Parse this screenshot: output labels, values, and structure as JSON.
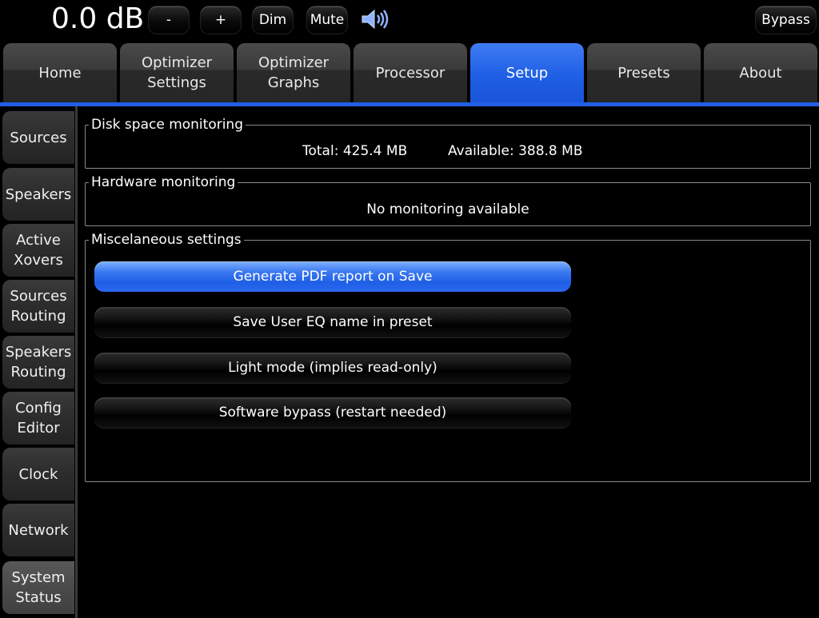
{
  "topbar": {
    "volume": "0.0 dB",
    "minus_label": "-",
    "plus_label": "+",
    "dim_label": "Dim",
    "mute_label": "Mute",
    "speaker_icon": "speaker-volume-icon",
    "bypass_label": "Bypass"
  },
  "tabs": [
    {
      "label": "Home"
    },
    {
      "label": "Optimizer\nSettings"
    },
    {
      "label": "Optimizer\nGraphs"
    },
    {
      "label": "Processor"
    },
    {
      "label": "Setup",
      "active": true
    },
    {
      "label": "Presets"
    },
    {
      "label": "About"
    }
  ],
  "sidebar": {
    "items": [
      {
        "label": "Sources"
      },
      {
        "label": "Speakers"
      },
      {
        "label": "Active\nXovers"
      },
      {
        "label": "Sources\nRouting"
      },
      {
        "label": "Speakers\nRouting"
      },
      {
        "label": "Config\nEditor"
      },
      {
        "label": "Clock"
      },
      {
        "label": "Network"
      },
      {
        "label": "System\nStatus",
        "active": true
      }
    ]
  },
  "disk": {
    "title": "Disk space monitoring",
    "total": "Total: 425.4 MB",
    "available": "Available: 388.8 MB"
  },
  "hardware": {
    "title": "Hardware monitoring",
    "status": "No monitoring available"
  },
  "misc": {
    "title": "Miscelaneous settings",
    "options": [
      {
        "label": "Generate PDF report on Save",
        "on": true
      },
      {
        "label": "Save User EQ name in preset",
        "on": false
      },
      {
        "label": "Light mode (implies read-only)",
        "on": false
      },
      {
        "label": "Software bypass (restart needed)",
        "on": false
      }
    ]
  },
  "colors": {
    "accent": "#1f5fe6",
    "background": "#000000",
    "tab_inactive": "#333333"
  }
}
